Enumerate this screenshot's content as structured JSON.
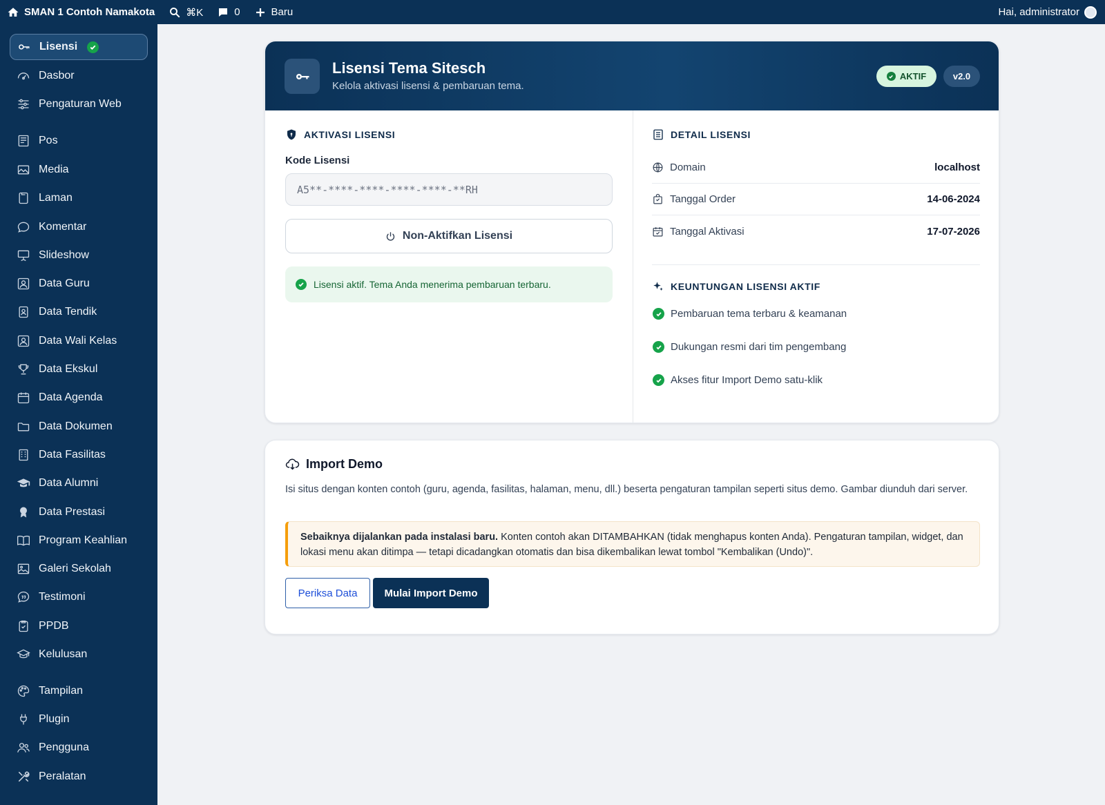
{
  "adminbar": {
    "site_name": "SMAN 1 Contoh Namakota",
    "shortcut": "⌘K",
    "comments_count": "0",
    "new_label": "Baru",
    "greeting": "Hai, administrator"
  },
  "sidebar": {
    "items": [
      {
        "label": "Lisensi",
        "icon": "key-icon",
        "active": true
      },
      {
        "label": "Dasbor",
        "icon": "dashboard-icon"
      },
      {
        "label": "Pengaturan Web",
        "icon": "sliders-icon"
      },
      {
        "label": "Pos",
        "icon": "post-icon"
      },
      {
        "label": "Media",
        "icon": "media-icon"
      },
      {
        "label": "Laman",
        "icon": "page-icon"
      },
      {
        "label": "Komentar",
        "icon": "comment-icon"
      },
      {
        "label": "Slideshow",
        "icon": "slideshow-icon"
      },
      {
        "label": "Data Guru",
        "icon": "teacher-icon"
      },
      {
        "label": "Data Tendik",
        "icon": "staff-icon"
      },
      {
        "label": "Data Wali Kelas",
        "icon": "homeroom-icon"
      },
      {
        "label": "Data Ekskul",
        "icon": "trophy-icon"
      },
      {
        "label": "Data Agenda",
        "icon": "calendar-icon"
      },
      {
        "label": "Data Dokumen",
        "icon": "folder-icon"
      },
      {
        "label": "Data Fasilitas",
        "icon": "building-icon"
      },
      {
        "label": "Data Alumni",
        "icon": "graduation-cap-icon"
      },
      {
        "label": "Data Prestasi",
        "icon": "award-icon"
      },
      {
        "label": "Program Keahlian",
        "icon": "book-icon"
      },
      {
        "label": "Galeri Sekolah",
        "icon": "gallery-icon"
      },
      {
        "label": "Testimoni",
        "icon": "quote-icon"
      },
      {
        "label": "PPDB",
        "icon": "clipboard-icon"
      },
      {
        "label": "Kelulusan",
        "icon": "graduation-icon"
      },
      {
        "label": "Tampilan",
        "icon": "palette-icon"
      },
      {
        "label": "Plugin",
        "icon": "plug-icon"
      },
      {
        "label": "Pengguna",
        "icon": "users-icon"
      },
      {
        "label": "Peralatan",
        "icon": "tools-icon"
      }
    ]
  },
  "license": {
    "title": "Lisensi Tema Sitesch",
    "subtitle": "Kelola aktivasi lisensi & pembaruan tema.",
    "status_badge": "AKTIF",
    "version_badge": "v2.0",
    "activation_title": "AKTIVASI LISENSI",
    "code_label": "Kode Lisensi",
    "code_value": "A5**-****-****-****-****-**RH",
    "deactivate_label": "Non-Aktifkan Lisensi",
    "success_notice": "Lisensi aktif. Tema Anda menerima pembaruan terbaru.",
    "detail_title": "DETAIL LISENSI",
    "details": [
      {
        "label": "Domain",
        "value": "localhost",
        "icon": "globe-icon"
      },
      {
        "label": "Tanggal Order",
        "value": "14-06-2024",
        "icon": "bag-icon"
      },
      {
        "label": "Tanggal Aktivasi",
        "value": "17-07-2026",
        "icon": "calendar-check-icon"
      }
    ],
    "benefits_title": "KEUNTUNGAN LISENSI AKTIF",
    "benefits": [
      "Pembaruan tema terbaru & keamanan",
      "Dukungan resmi dari tim pengembang",
      "Akses fitur Import Demo satu-klik"
    ]
  },
  "import_demo": {
    "title": "Import Demo",
    "description": "Isi situs dengan konten contoh (guru, agenda, fasilitas, halaman, menu, dll.) beserta pengaturan tampilan seperti situs demo. Gambar diunduh dari server.",
    "warning_bold": "Sebaiknya dijalankan pada instalasi baru.",
    "warning_text": " Konten contoh akan DITAMBAHKAN (tidak menghapus konten Anda). Pengaturan tampilan, widget, dan lokasi menu akan ditimpa — tetapi dicadangkan otomatis dan bisa dikembalikan lewat tombol \"Kembalikan (Undo)\".",
    "check_button": "Periksa Data",
    "import_button": "Mulai Import Demo"
  },
  "colors": {
    "primary": "#0b3156",
    "success": "#16a34a",
    "warning": "#f59e0b",
    "background": "#f0f2f5"
  }
}
